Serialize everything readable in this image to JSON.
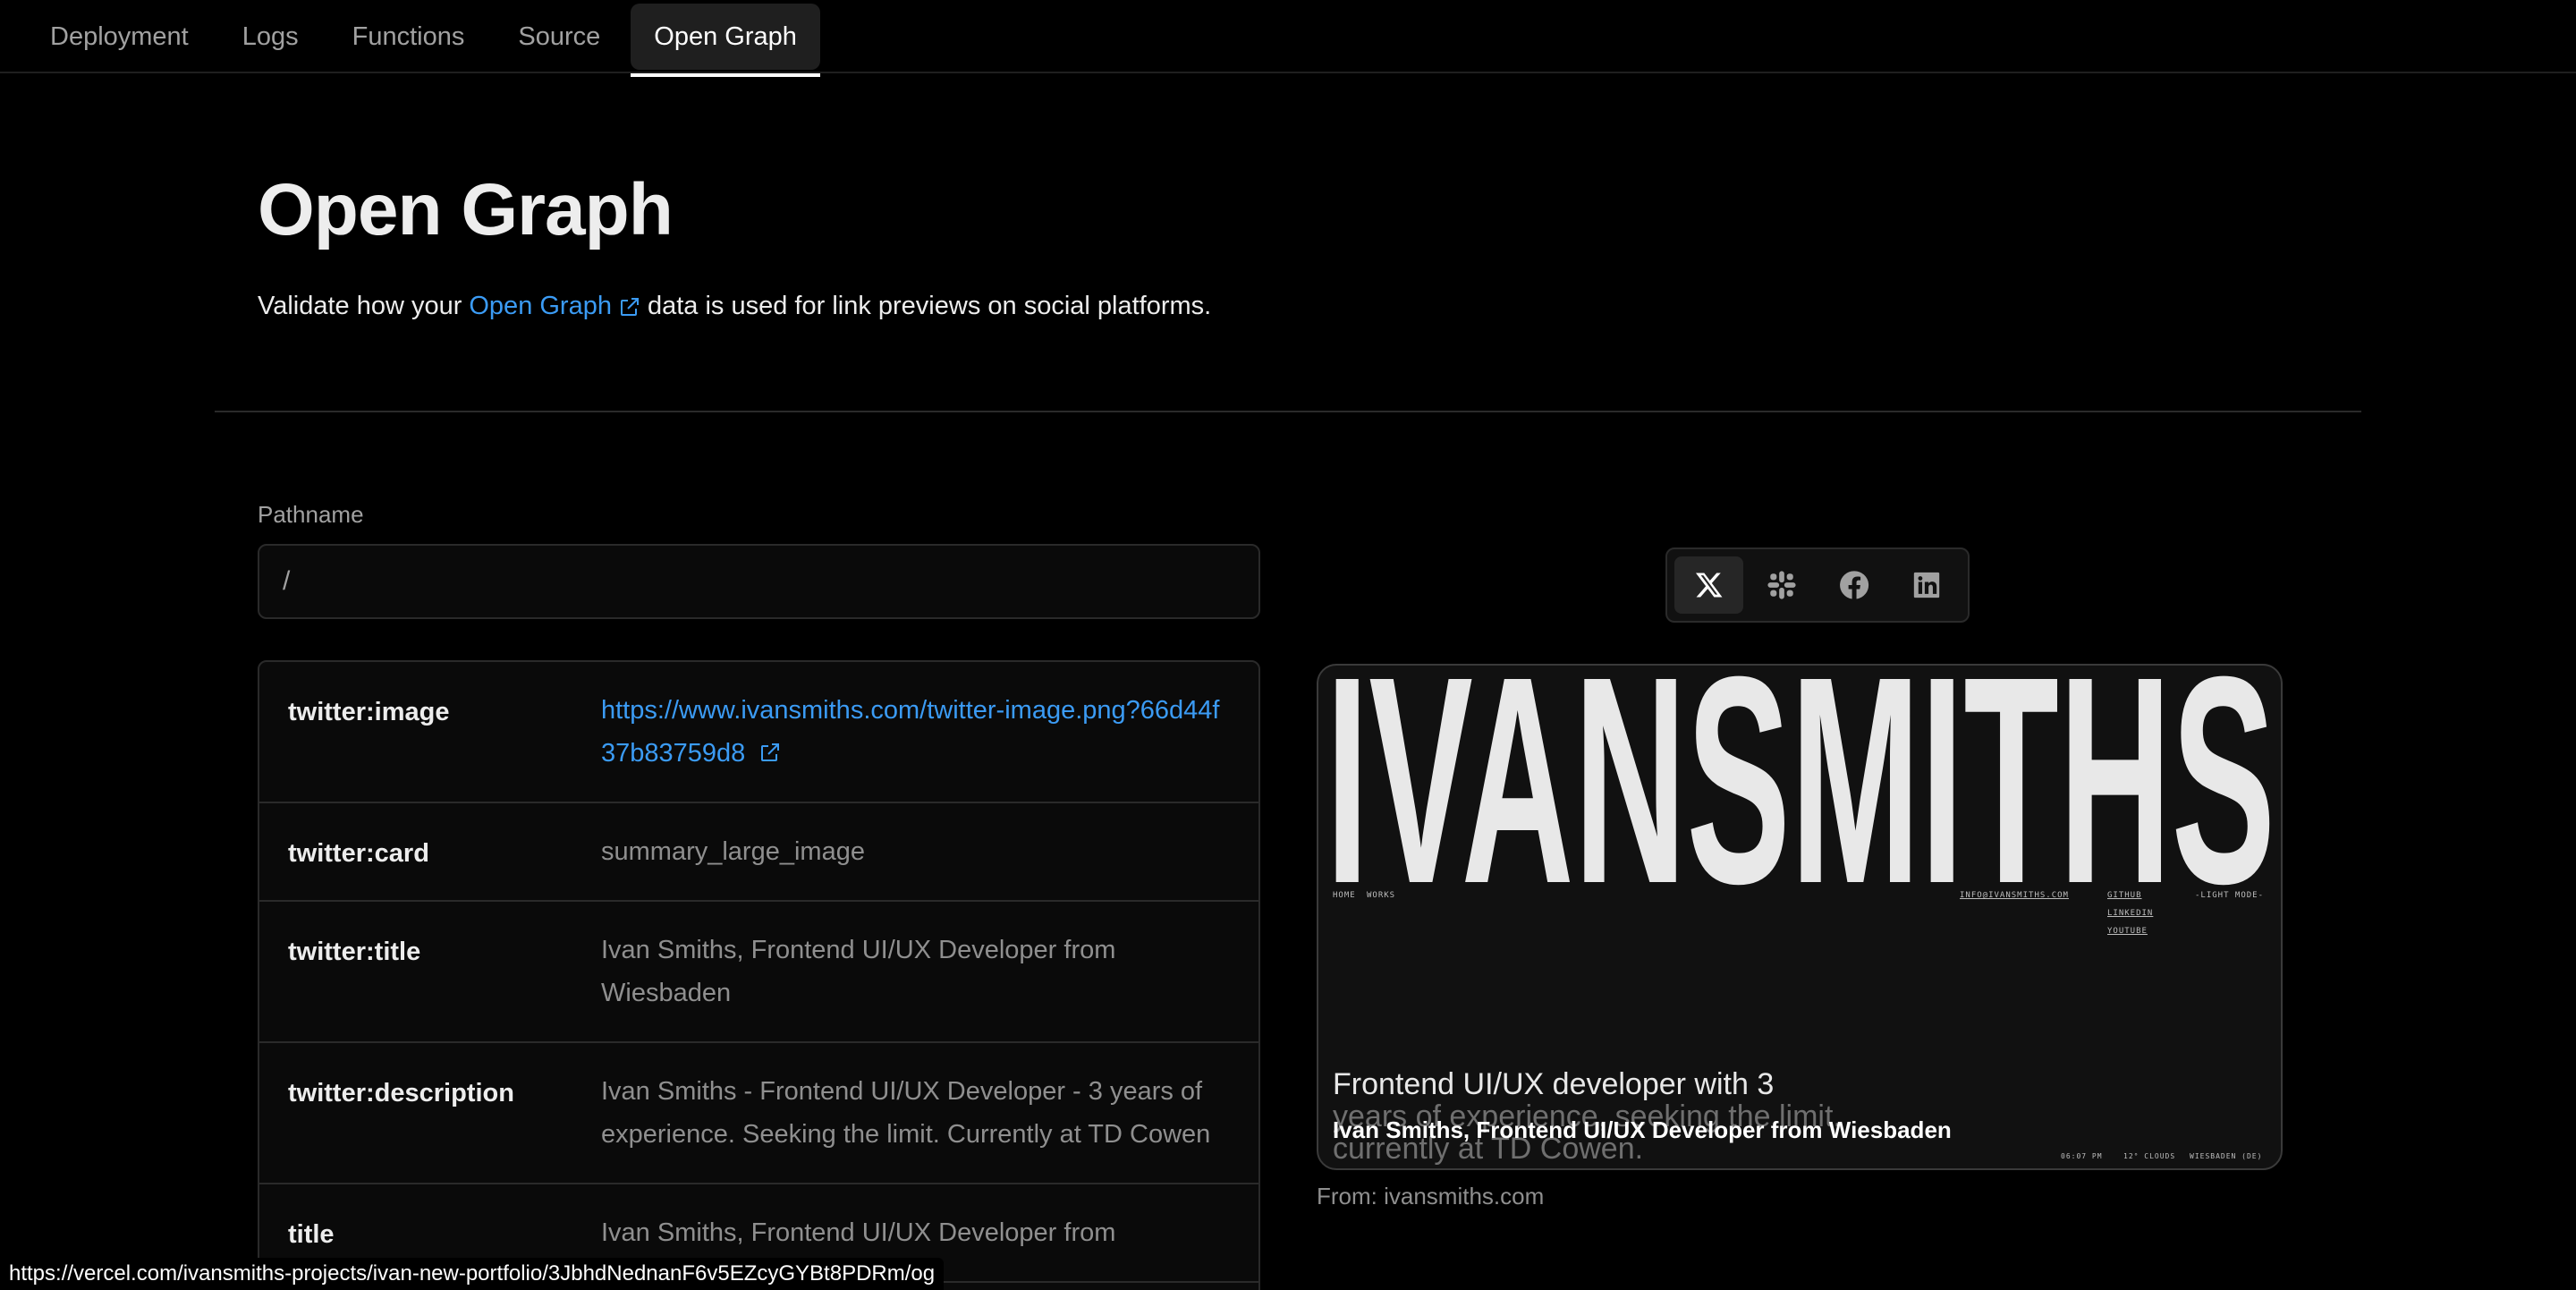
{
  "tabs": [
    "Deployment",
    "Logs",
    "Functions",
    "Source",
    "Open Graph"
  ],
  "active_tab": "Open Graph",
  "header": {
    "title": "Open Graph",
    "subtitle_before": "Validate how your",
    "subtitle_link": "Open Graph",
    "subtitle_after": "data is used for link previews on social platforms."
  },
  "pathname": {
    "label": "Pathname",
    "value": "/"
  },
  "meta_rows": [
    {
      "key": "twitter:image",
      "value": "https://www.ivansmiths.com/twitter-image.png?66d44f37b83759d8",
      "is_link": true
    },
    {
      "key": "twitter:card",
      "value": "summary_large_image"
    },
    {
      "key": "twitter:title",
      "value": "Ivan Smiths, Frontend UI/UX Developer from Wiesbaden"
    },
    {
      "key": "twitter:description",
      "value": "Ivan Smiths - Frontend UI/UX Developer - 3 years of experience. Seeking the limit. Currently at TD Cowen"
    },
    {
      "key": "title",
      "value": "Ivan Smiths, Frontend UI/UX Developer from"
    }
  ],
  "platforms": [
    {
      "name": "x",
      "icon": "x-icon",
      "active": true
    },
    {
      "name": "slack",
      "icon": "slack-icon",
      "active": false
    },
    {
      "name": "facebook",
      "icon": "facebook-icon",
      "active": false
    },
    {
      "name": "linkedin",
      "icon": "linkedin-icon",
      "active": false
    }
  ],
  "preview": {
    "logo_text": "IVANSMITHS",
    "nav_home": "HOME",
    "nav_works": "WORKS",
    "email": "INFO@IVANSMITHS.COM",
    "social_github": "GITHUB",
    "social_linkedin": "LINKEDIN",
    "social_youtube": "YOUTUBE",
    "mode": "-LIGHT MODE-",
    "tagline_line1": "Frontend UI/UX developer with 3",
    "tagline_line2": "years of experience, seeking the limit,",
    "tagline_line3": "currently at TD Cowen.",
    "title_overlay": "Ivan Smiths, Frontend UI/UX Developer from Wiesbaden",
    "time": "06:07 PM",
    "weather": "12° CLOUDS",
    "location": "WIESBADEN (DE)",
    "from": "From: ivansmiths.com"
  },
  "status_url": "https://vercel.com/ivansmiths-projects/ivan-new-portfolio/3JbhdNednanF6v5EZcyGYBt8PDRm/og"
}
